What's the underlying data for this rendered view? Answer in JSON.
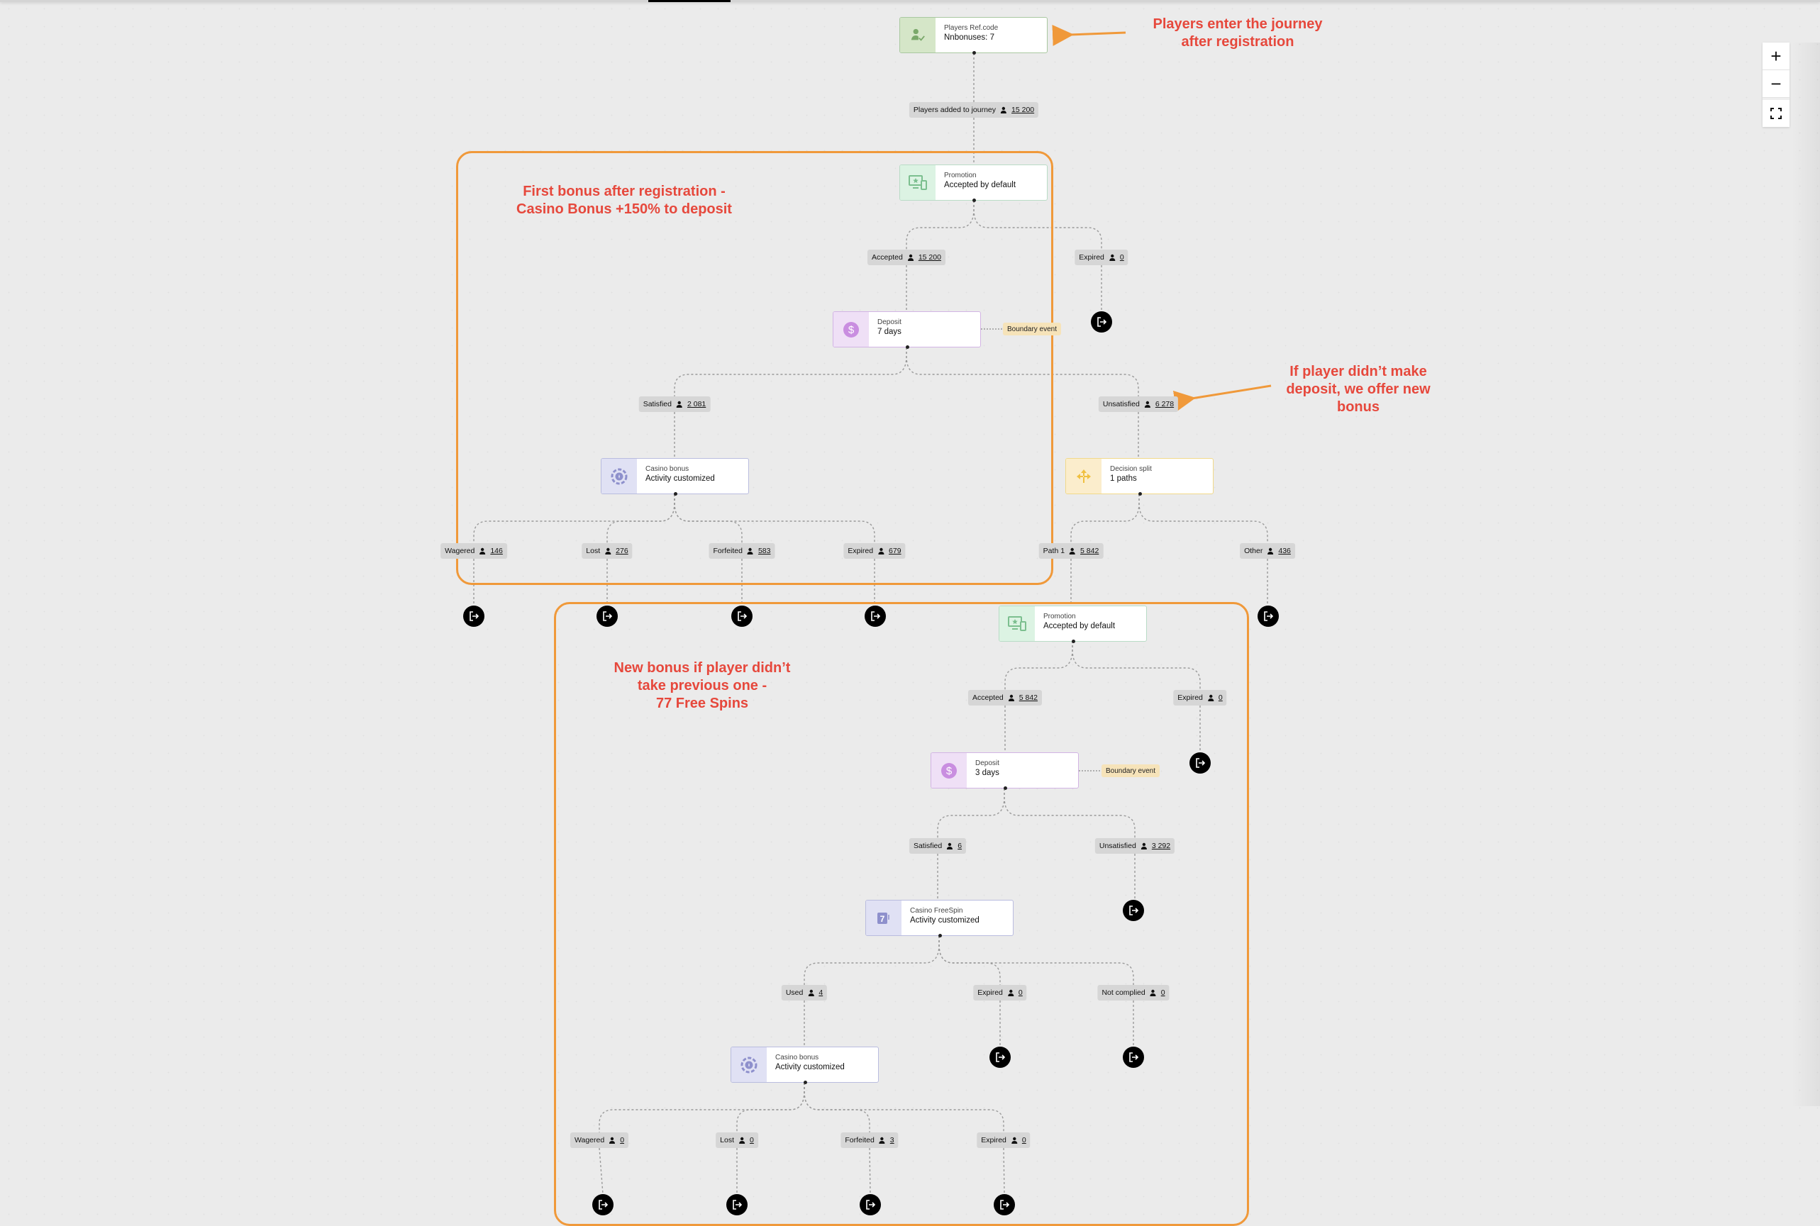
{
  "canvas": {
    "background": "#ebebeb",
    "link_color": "#9a9a9a",
    "annotation_color": "#e6483c",
    "group_border_color": "#f0993a"
  },
  "zoom_controls": {
    "zoom_in": "+",
    "zoom_out": "−"
  },
  "nodes": {
    "entry": {
      "title": "Players Ref.code",
      "sub": "Nnbonuses: 7",
      "icon": "user-check-icon"
    },
    "promotion1": {
      "title": "Promotion",
      "sub": "Accepted by default",
      "icon": "promotion-devices-icon"
    },
    "deposit1": {
      "title": "Deposit",
      "sub": "7 days",
      "icon": "dollar-icon"
    },
    "casino1": {
      "title": "Casino bonus",
      "sub": "Activity customized",
      "icon": "casino-chip-icon"
    },
    "split": {
      "title": "Decision split",
      "sub": "1 paths",
      "icon": "split-arrows-icon"
    },
    "promotion2": {
      "title": "Promotion",
      "sub": "Accepted by default",
      "icon": "promotion-devices-icon"
    },
    "deposit2": {
      "title": "Deposit",
      "sub": "3 days",
      "icon": "dollar-icon"
    },
    "freespin": {
      "title": "Casino FreeSpin",
      "sub": "Activity customized",
      "icon": "freespin-seven-icon"
    },
    "casino2": {
      "title": "Casino bonus",
      "sub": "Activity customized",
      "icon": "casino-chip-icon"
    }
  },
  "boundary_event_label": "Boundary event",
  "labels": {
    "added": {
      "text": "Players added to journey",
      "count": "15 200"
    },
    "p1_accepted": {
      "text": "Accepted",
      "count": "15 200"
    },
    "p1_expired": {
      "text": "Expired",
      "count": "0"
    },
    "d1_satisfied": {
      "text": "Satisfied",
      "count": "2 081"
    },
    "d1_unsatisfied": {
      "text": "Unsatisfied",
      "count": "6 278"
    },
    "c1_wagered": {
      "text": "Wagered",
      "count": "146"
    },
    "c1_lost": {
      "text": "Lost",
      "count": "276"
    },
    "c1_forfeited": {
      "text": "Forfeited",
      "count": "583"
    },
    "c1_expired": {
      "text": "Expired",
      "count": "679"
    },
    "s_path1": {
      "text": "Path 1",
      "count": "5 842"
    },
    "s_other": {
      "text": "Other",
      "count": "436"
    },
    "p2_accepted": {
      "text": "Accepted",
      "count": "5 842"
    },
    "p2_expired": {
      "text": "Expired",
      "count": "0"
    },
    "d2_satisfied": {
      "text": "Satisfied",
      "count": "6"
    },
    "d2_unsatisfied": {
      "text": "Unsatisfied",
      "count": "3 292"
    },
    "f_used": {
      "text": "Used",
      "count": "4"
    },
    "f_expired": {
      "text": "Expired",
      "count": "0"
    },
    "f_notcomplied": {
      "text": "Not complied",
      "count": "0"
    },
    "c2_wagered": {
      "text": "Wagered",
      "count": "0"
    },
    "c2_lost": {
      "text": "Lost",
      "count": "0"
    },
    "c2_forfeited": {
      "text": "Forfeited",
      "count": "3"
    },
    "c2_expired": {
      "text": "Expired",
      "count": "0"
    }
  },
  "annotations": {
    "entry": "Players enter the journey\nafter registration",
    "first_bonus": "First bonus after registration -\nCasino Bonus +150% to deposit",
    "no_deposit": "If player didn’t make\ndeposit, we offer new\nbonus",
    "new_bonus": "New bonus if player didn’t\ntake previous one -\n77 Free Spins"
  }
}
